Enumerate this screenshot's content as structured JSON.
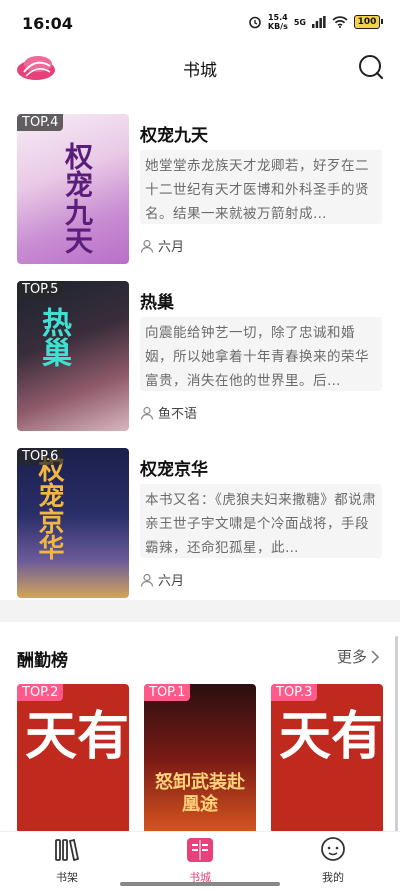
{
  "status": {
    "time": "16:04",
    "speed_value": "15.4",
    "speed_unit": "KB/s",
    "network": "5G",
    "battery": "100"
  },
  "header": {
    "title": "书城"
  },
  "books": [
    {
      "rank": "TOP.4",
      "title": "权宠九天",
      "cover_text": "权宠九天",
      "description": "她堂堂赤龙族天才龙卿若，好歹在二十二世纪有天才医博和外科圣手的贤名。结果一来就被万箭射成…",
      "author": "六月"
    },
    {
      "rank": "TOP.5",
      "title": "热巢",
      "cover_text": "热巢",
      "description": "向震能给钟艺一切，除了忠诚和婚姻，所以她拿着十年青春换来的荣华富贵，消失在他的世界里。后…",
      "author": "鱼不语"
    },
    {
      "rank": "TOP.6",
      "title": "权宠京华",
      "cover_text": "权宠京华",
      "description": "本书又名：《虎狼夫妇来撒糖》都说肃亲王世子宇文啸是个冷面战将，手段霸辣，还命犯孤星，此…",
      "author": "六月"
    }
  ],
  "section": {
    "title": "酬勤榜",
    "more": "更多",
    "cards": [
      {
        "rank": "TOP.2",
        "cover_text": "天有"
      },
      {
        "rank": "TOP.1",
        "cover_text": "怒卸武装赴凰途"
      },
      {
        "rank": "TOP.3",
        "cover_text": "天有"
      }
    ]
  },
  "nav": {
    "shelf": "书架",
    "store": "书城",
    "mine": "我的"
  },
  "colors": {
    "accent": "#e8407a",
    "rank_badge": "#ff5a8a"
  }
}
